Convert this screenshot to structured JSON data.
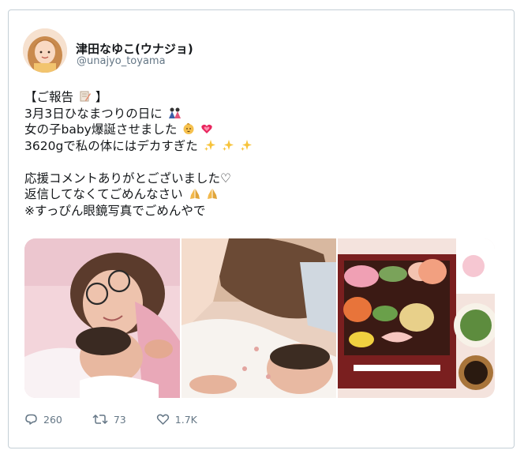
{
  "user": {
    "display_name": "津田なゆこ(ウナジョ)",
    "handle": "@unajyo_toyama"
  },
  "tweet": {
    "lines": [
      "【ご報告",
      "3月3日ひなまつりの日に",
      "女の子baby爆誕させました",
      "3620gで私の体にはデカすぎた",
      "応援コメントありがとございました♡",
      "返信してなくてごめんなさい",
      "※すっぴん眼鏡写真でごめんやで"
    ],
    "line0_suffix": "】"
  },
  "icons": [
    "memo-emoji",
    "hina-dolls-emoji",
    "baby-emoji",
    "growing-heart-emoji",
    "sparkles-emoji",
    "folded-hands-emoji",
    "reply-icon",
    "retweet-icon",
    "like-icon"
  ],
  "media": {
    "photos": [
      "mother-with-newborn-photo",
      "newborn-swaddled-photo",
      "hinamatsuri-meal-photo"
    ]
  },
  "stats": {
    "replies": "260",
    "retweets": "73",
    "likes": "1.7K"
  },
  "colors": {
    "text": "#14171a",
    "secondary": "#657786",
    "border": "#c4cfd6"
  }
}
